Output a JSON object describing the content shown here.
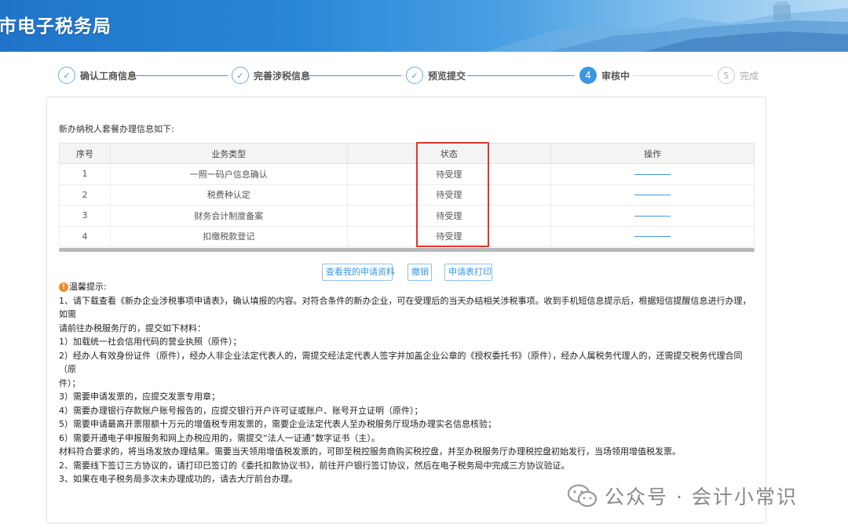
{
  "header": {
    "title": "市电子税务局"
  },
  "steps": [
    {
      "label": "确认工商信息",
      "marker": "✓",
      "state": "done"
    },
    {
      "label": "完善涉税信息",
      "marker": "✓",
      "state": "done"
    },
    {
      "label": "预览提交",
      "marker": "✓",
      "state": "done"
    },
    {
      "label": "审核中",
      "marker": "4",
      "state": "active"
    },
    {
      "label": "完成",
      "marker": "5",
      "state": "pending"
    }
  ],
  "main": {
    "intro": "新办纳税人套餐办理信息如下:",
    "table": {
      "headers": [
        "序号",
        "业务类型",
        "状态",
        "操作"
      ],
      "rows": [
        {
          "idx": "1",
          "type": "一照一码户信息确认",
          "status": "待受理"
        },
        {
          "idx": "2",
          "type": "税费种认定",
          "status": "待受理"
        },
        {
          "idx": "3",
          "type": "财务会计制度备案",
          "status": "待受理"
        },
        {
          "idx": "4",
          "type": "扣缴税款登记",
          "status": "待受理"
        }
      ]
    },
    "buttons": {
      "view_materials": "查看我的申请资料",
      "revoke": "撤销",
      "print_form": "申请表打印"
    },
    "notes": {
      "title": "温馨提示:",
      "lines": [
        "1、请下载查看《新办企业涉税事项申请表》，确认填报的内容。对符合条件的新办企业，可在受理后的当天办结相关涉税事项。收到手机短信息提示后，根据短信提醒信息进行办理，如需",
        "请前往办税服务厅的，提交如下材料：",
        "1）加载统一社会信用代码的营业执照（原件）；",
        "2）经办人有效身份证件（原件），经办人非企业法定代表人的，需提交经法定代表人签字并加盖企业公章的《授权委托书》（原件），经办人属税务代理人的，还需提交税务代理合同（原",
        "件）；",
        "3）需要申请发票的，应提交发票专用章；",
        "4）需要办理银行存款账户账号报告的，应提交银行开户许可证或账户、账号开立证明（原件）；",
        "5）需要申请最高开票限额十万元的增值税专用发票的，需要企业法定代表人至办税服务厅现场办理实名信息核验；",
        "6）需要开通电子申报服务和网上办税应用的，需提交“法人一证通”数字证书（主）。",
        "材料符合要求的，将当场发放办理结果。需要当天领用增值税发票的，可即至税控服务商购买税控盘，并至办税服务厅办理税控盘初始发行，当场领用增值税发票。",
        "2、需要线下签订三方协议的，请打印已签订的《委托扣款协议书》，前往开户银行签订协议，然后在电子税务局中完成三方协议验证。",
        "3、如果在电子税务局多次未办理成功的，请去大厅前台办理。"
      ]
    }
  },
  "watermark": {
    "text": "公众号 · 会计小常识"
  },
  "colors": {
    "accent": "#3c97e0",
    "highlight_box": "#e8342a",
    "warning": "#f08a24"
  }
}
